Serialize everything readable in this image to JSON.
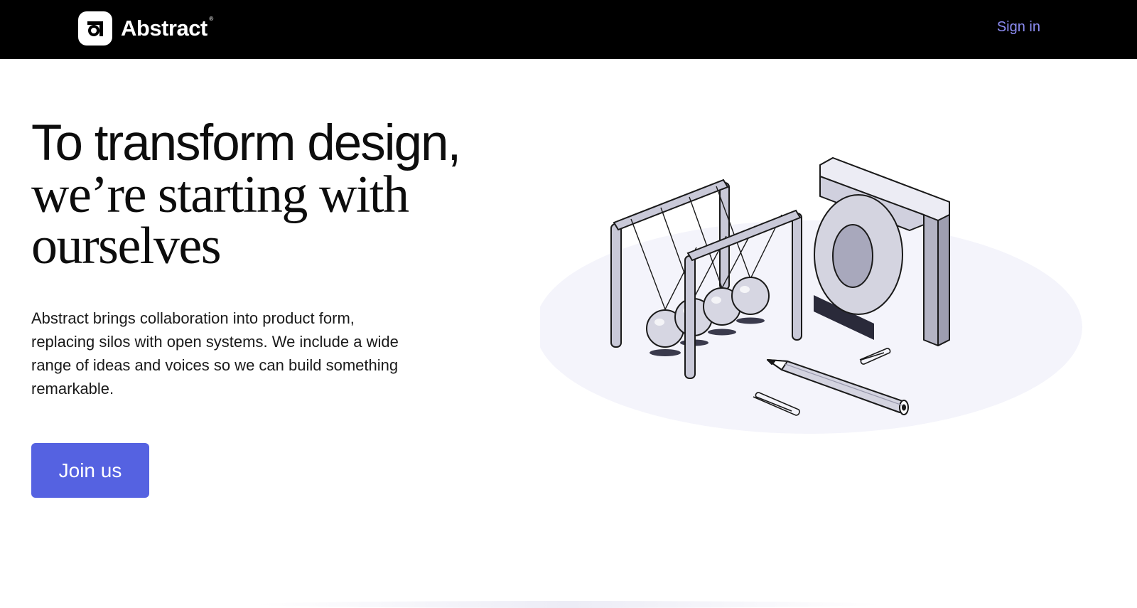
{
  "header": {
    "brand_name": "Abstract",
    "brand_trademark": "®",
    "logo_icon": "abstract-logo-icon",
    "signin_label": "Sign in"
  },
  "hero": {
    "title_line1": "To transform design,",
    "title_line2": "we’re starting with",
    "title_line3": "ourselves",
    "body": "Abstract brings collaboration into product form, replacing silos with open systems. We include a wide range of ideas and voices so we can build something remarkable.",
    "cta_label": "Join us"
  },
  "illustration": {
    "icon": "newtons-cradle-and-logo-illustration"
  },
  "colors": {
    "topbar_bg": "#000000",
    "signin_link": "#8c8cf2",
    "cta_bg": "#5562e1",
    "illustration_floor": "#f4f4fb"
  }
}
